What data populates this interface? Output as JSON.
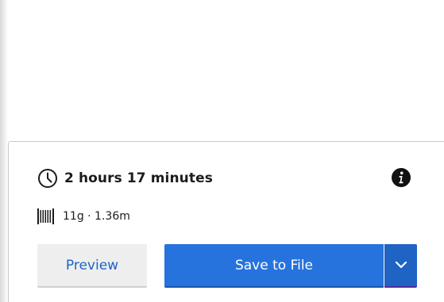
{
  "print_info": {
    "estimated_time": "2 hours 17 minutes",
    "material_estimate": "11g · 1.36m"
  },
  "actions": {
    "preview_label": "Preview",
    "save_label": "Save to File"
  },
  "icons": {
    "time": "clock-icon",
    "info": "info-icon",
    "material": "filament-spool-icon",
    "dropdown": "chevron-down-icon"
  },
  "colors": {
    "primary": "#2673dd",
    "primary_dark": "#1f63c4",
    "secondary_bg": "#eeeeee",
    "secondary_text": "#1e63c6",
    "text": "#1c1c1c"
  }
}
